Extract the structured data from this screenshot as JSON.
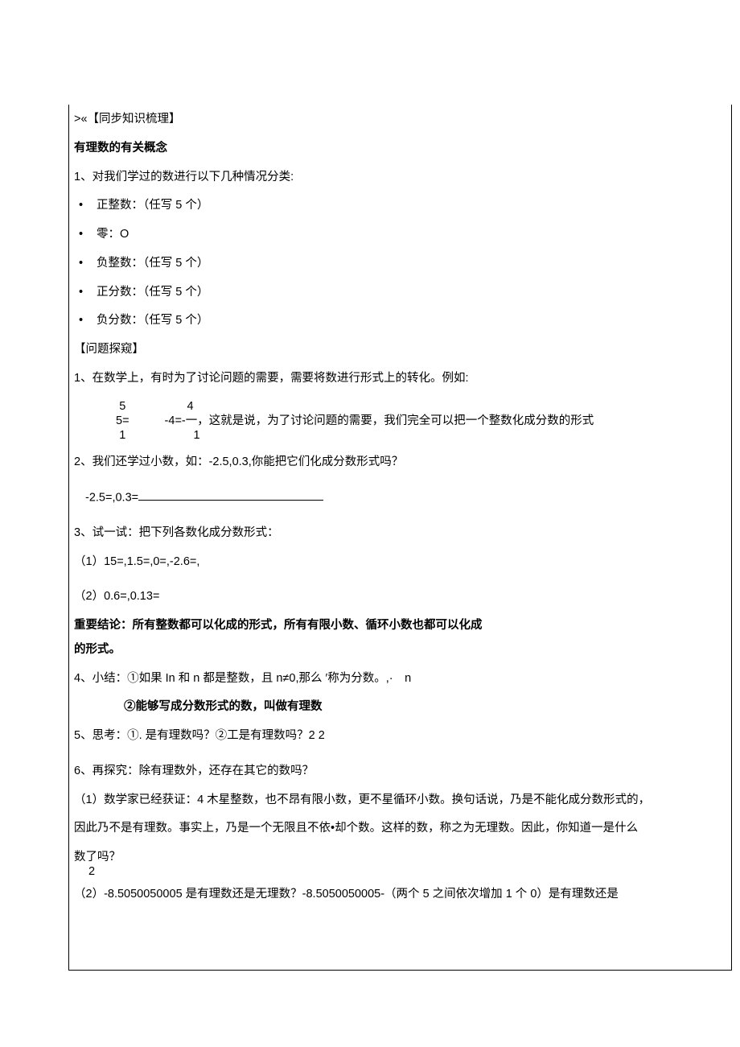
{
  "section_title": ">«【同步知识梳理】",
  "topic_title": "有理数的有关概念",
  "item1_intro": "1、对我们学过的数进行以下几种情况分类:",
  "bullets": {
    "b1": "正整数：（任写 5 个）",
    "b2": "零：O",
    "b3": "负整数：（任写 5 个）",
    "b4": "正分数：（任写 5 个）",
    "b5": "负分数：（任写 5 个）"
  },
  "explore_title": "【问题探窥】",
  "p1": "1、在数学上，有时为了讨论问题的需要，需要将数进行形式上的转化。例如:",
  "frac": {
    "top1": "5",
    "eq1": "5=",
    "bot1": "1",
    "top2": "4",
    "eq2": "-4=-一，这就是说，为了讨论问题的需要，我们完全可以把一个整数化成分数的形式",
    "bot2": "1"
  },
  "p2": "2、我们还学过小数，如：-2.5,0.3,你能把它们化成分数形式吗？",
  "p2_fill": "-2.5=,0.3=",
  "p3": "3、试一试：把下列各数化成分数形式：",
  "p3_1": "（1）15=,1.5=,0=,-2.6=,",
  "p3_2": "（2）0.6=,0.13=",
  "conclusion_line1": "重要结论：所有整数都可以化成的形式，所有有限小数、循环小数也都可以化成",
  "conclusion_line2": "的形式。",
  "p4": "4、小结：①如果 In 和 n 都是整数，且 n≠0,那么 ′称为分数。,· n",
  "p4_sub": "②能够写成分数形式的数，叫做有理数",
  "p5": "5、思考：①. 是有理数吗？②工是有理数吗？2  2",
  "p6": "6、再探究：除有理数外，还存在其它的数吗？",
  "p6_1": "（1）数学家已经获证：4 木星整数，也不昂有限小数，更不星循环小数。换句话说，乃是不能化成分数形式的，",
  "p6_1b": "因此乃不是有理数。事实上，乃是一个无限且不依•却个数。这样的数，称之为无理数。因此，你知道一是什么",
  "p6_1c": "数了吗？",
  "p6_1c_sub": "2",
  "p6_2": "（2）-8.5050050005 是有理数还是无理数？-8.5050050005-（两个 5 之间依次增加 1 个 0）是有理数还是"
}
